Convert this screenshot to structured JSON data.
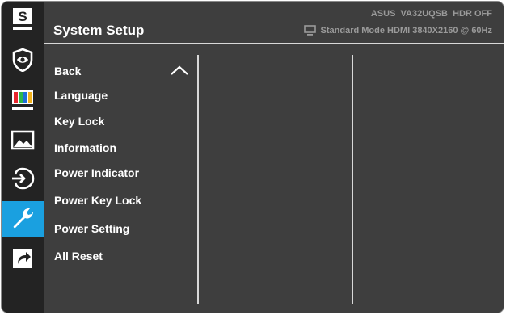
{
  "sidebar": {
    "items": [
      {
        "icon": "splendid-icon",
        "label": "S",
        "active": false
      },
      {
        "icon": "eye-care-icon",
        "active": false
      },
      {
        "icon": "color-icon",
        "active": false
      },
      {
        "icon": "image-icon",
        "active": false
      },
      {
        "icon": "input-select-icon",
        "active": false
      },
      {
        "icon": "system-setup-wrench-icon",
        "active": true
      },
      {
        "icon": "shortcut-icon",
        "active": false
      }
    ]
  },
  "header": {
    "title": "System Setup",
    "model_info": "ASUS  VA32UQSB  HDR OFF",
    "status": "Standard Mode HDMI 3840X2160 @ 60Hz",
    "status_icon": "monitor-icon"
  },
  "menu": {
    "items": [
      {
        "label": "Back"
      },
      {
        "label": "Language"
      },
      {
        "label": "Key Lock"
      },
      {
        "label": "Information"
      },
      {
        "label": "Power Indicator"
      },
      {
        "label": "Power Key Lock"
      },
      {
        "label": "Power Setting"
      },
      {
        "label": "All Reset"
      }
    ],
    "selected_chevron": "chevron-up-icon"
  },
  "colors": {
    "sidebar_bg": "#232323",
    "panel_bg": "#3e3e3e",
    "active_accent": "#1aa0e0",
    "text": "#ffffff",
    "muted_text": "#9a9a9a"
  }
}
